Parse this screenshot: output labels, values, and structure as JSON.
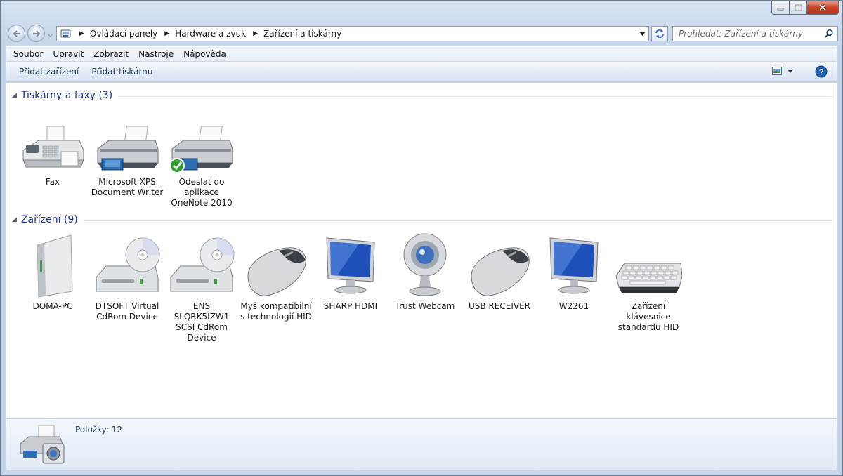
{
  "address": {
    "breadcrumbs": [
      "Ovládací panely",
      "Hardware a zvuk",
      "Zařízení a tiskárny"
    ]
  },
  "search": {
    "placeholder": "Prohledat: Zařízení a tiskárny"
  },
  "menu": [
    "Soubor",
    "Upravit",
    "Zobrazit",
    "Nástroje",
    "Nápověda"
  ],
  "commands": {
    "add_device": "Přidat zařízení",
    "add_printer": "Přidat tiskárnu"
  },
  "groups": {
    "printers": {
      "title": "Tiskárny a faxy (3)",
      "items": [
        {
          "label": "Fax",
          "icon": "fax-icon"
        },
        {
          "label": "Microsoft XPS Document Writer",
          "icon": "printer-icon"
        },
        {
          "label": "Odeslat do aplikace OneNote 2010",
          "icon": "printer-default-icon"
        }
      ]
    },
    "devices": {
      "title": "Zařízení (9)",
      "items": [
        {
          "label": "DOMA-PC",
          "icon": "computer-tower-icon"
        },
        {
          "label": "DTSOFT Virtual CdRom Device",
          "icon": "cdrom-drive-icon"
        },
        {
          "label": "ENS SLQRK5IZW1 SCSI CdRom Device",
          "icon": "cdrom-drive-icon"
        },
        {
          "label": "Myš kompatibilní s technologií HID",
          "icon": "mouse-icon"
        },
        {
          "label": "SHARP HDMI",
          "icon": "monitor-icon"
        },
        {
          "label": "Trust Webcam",
          "icon": "webcam-icon"
        },
        {
          "label": "USB RECEIVER",
          "icon": "mouse-icon"
        },
        {
          "label": "W2261",
          "icon": "monitor-icon"
        },
        {
          "label": "Zařízení klávesnice standardu HID",
          "icon": "keyboard-icon"
        }
      ]
    }
  },
  "details": {
    "count_text": "Položky: 12"
  },
  "colors": {
    "group_title": "#1e3287",
    "command_text": "#1e395b",
    "close_button": "#c8442a"
  }
}
